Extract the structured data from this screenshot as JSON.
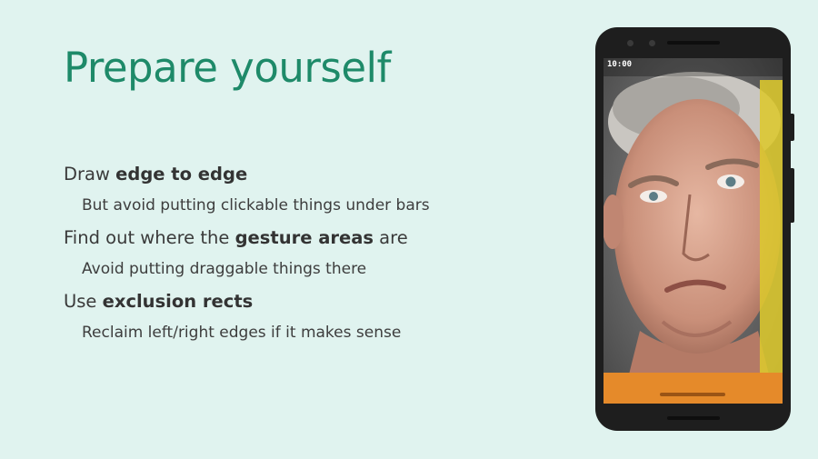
{
  "slide": {
    "title": "Prepare yourself"
  },
  "bullets": [
    {
      "level": 1,
      "before": "Draw ",
      "bold": "edge to edge",
      "after": ""
    },
    {
      "level": 2,
      "text": "But avoid putting clickable things under bars"
    },
    {
      "level": 1,
      "before": "Find out where the ",
      "bold": "gesture areas",
      "after": " are"
    },
    {
      "level": 2,
      "text": "Avoid putting draggable things there"
    },
    {
      "level": 1,
      "before": "Use ",
      "bold": "exclusion rects",
      "after": ""
    },
    {
      "level": 2,
      "text": "Reclaim left/right edges if it makes sense"
    }
  ],
  "phone": {
    "status_time": "10:00",
    "overlay_colors": {
      "edge_gesture_zone": "#dcc82e",
      "nav_gesture_zone": "#e58a2a"
    }
  },
  "colors": {
    "background": "#e0f3ef",
    "title": "#1e8a69",
    "body_text": "#3a3a3a"
  }
}
